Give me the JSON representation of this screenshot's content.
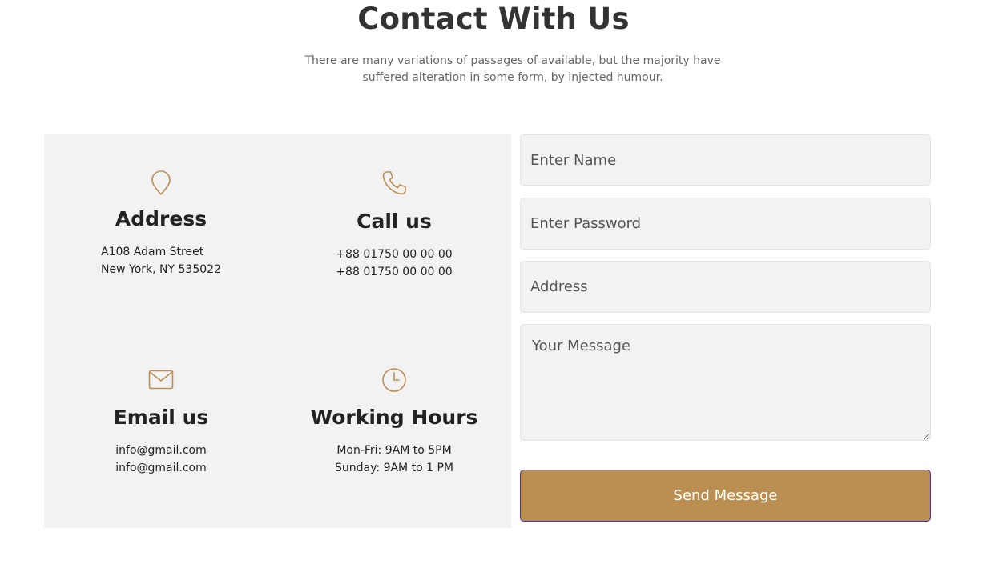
{
  "header": {
    "title": "Contact With Us",
    "subtitle": "There are many variations of passages of available, but the majority have suffered alteration in some form, by injected humour."
  },
  "info": {
    "accent_color": "#bb8e52",
    "address": {
      "icon": "map-pin-icon",
      "title": "Address",
      "lines": [
        "A108 Adam Street",
        "New York, NY 535022"
      ]
    },
    "call": {
      "icon": "phone-icon",
      "title": "Call us",
      "lines": [
        "+88 01750 00 00 00",
        "+88 01750 00 00 00"
      ]
    },
    "email": {
      "icon": "envelope-icon",
      "title": "Email us",
      "lines": [
        "info@gmail.com",
        "info@gmail.com"
      ]
    },
    "hours": {
      "icon": "clock-icon",
      "title": "Working Hours",
      "lines": [
        "Mon-Fri: 9AM to 5PM",
        "Sunday: 9AM to 1 PM"
      ]
    }
  },
  "form": {
    "name_placeholder": "Enter Name",
    "password_placeholder": "Enter Password",
    "address_placeholder": "Address",
    "message_placeholder": "Your Message",
    "submit_label": "Send Message",
    "button_color": "#bb8e52"
  }
}
